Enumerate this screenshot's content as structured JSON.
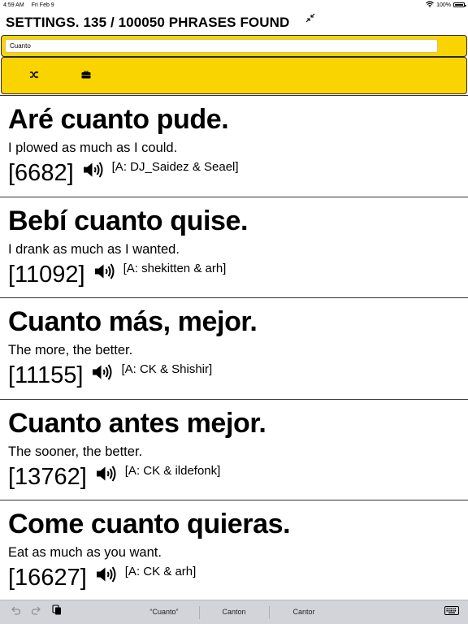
{
  "status": {
    "time": "4:59 AM",
    "date": "Fri Feb 9",
    "battery": "100%",
    "battery_level": 1.0
  },
  "header": {
    "title": "SETTINGS. 135 / 100050 PHRASES FOUND"
  },
  "search": {
    "value": "Cuanto"
  },
  "toolbar": {
    "shuffle_icon": "shuffle-icon",
    "briefcase_icon": "briefcase-icon"
  },
  "phrases": [
    {
      "text": "Aré cuanto pude.",
      "translation": "I plowed as much as I could.",
      "id": "[6682]",
      "attribution": "[A: DJ_Saidez & Seael]"
    },
    {
      "text": "Bebí cuanto quise.",
      "translation": "I drank as much as I wanted.",
      "id": "[11092]",
      "attribution": "[A: shekitten & arh]"
    },
    {
      "text": "Cuanto más, mejor.",
      "translation": "The more, the better.",
      "id": "[11155]",
      "attribution": "[A: CK & Shishir]"
    },
    {
      "text": "Cuanto antes mejor.",
      "translation": "The sooner, the better.",
      "id": "[13762]",
      "attribution": "[A: CK & ildefonk]"
    },
    {
      "text": "Come cuanto quieras.",
      "translation": "Eat as much as you want.",
      "id": "[16627]",
      "attribution": "[A: CK & arh]"
    }
  ],
  "keyboard": {
    "suggestions": [
      "“Cuanto”",
      "Canton",
      "Cantor"
    ]
  },
  "colors": {
    "accent": "#f9d400",
    "keyboard_bar": "#d2d4d9"
  }
}
